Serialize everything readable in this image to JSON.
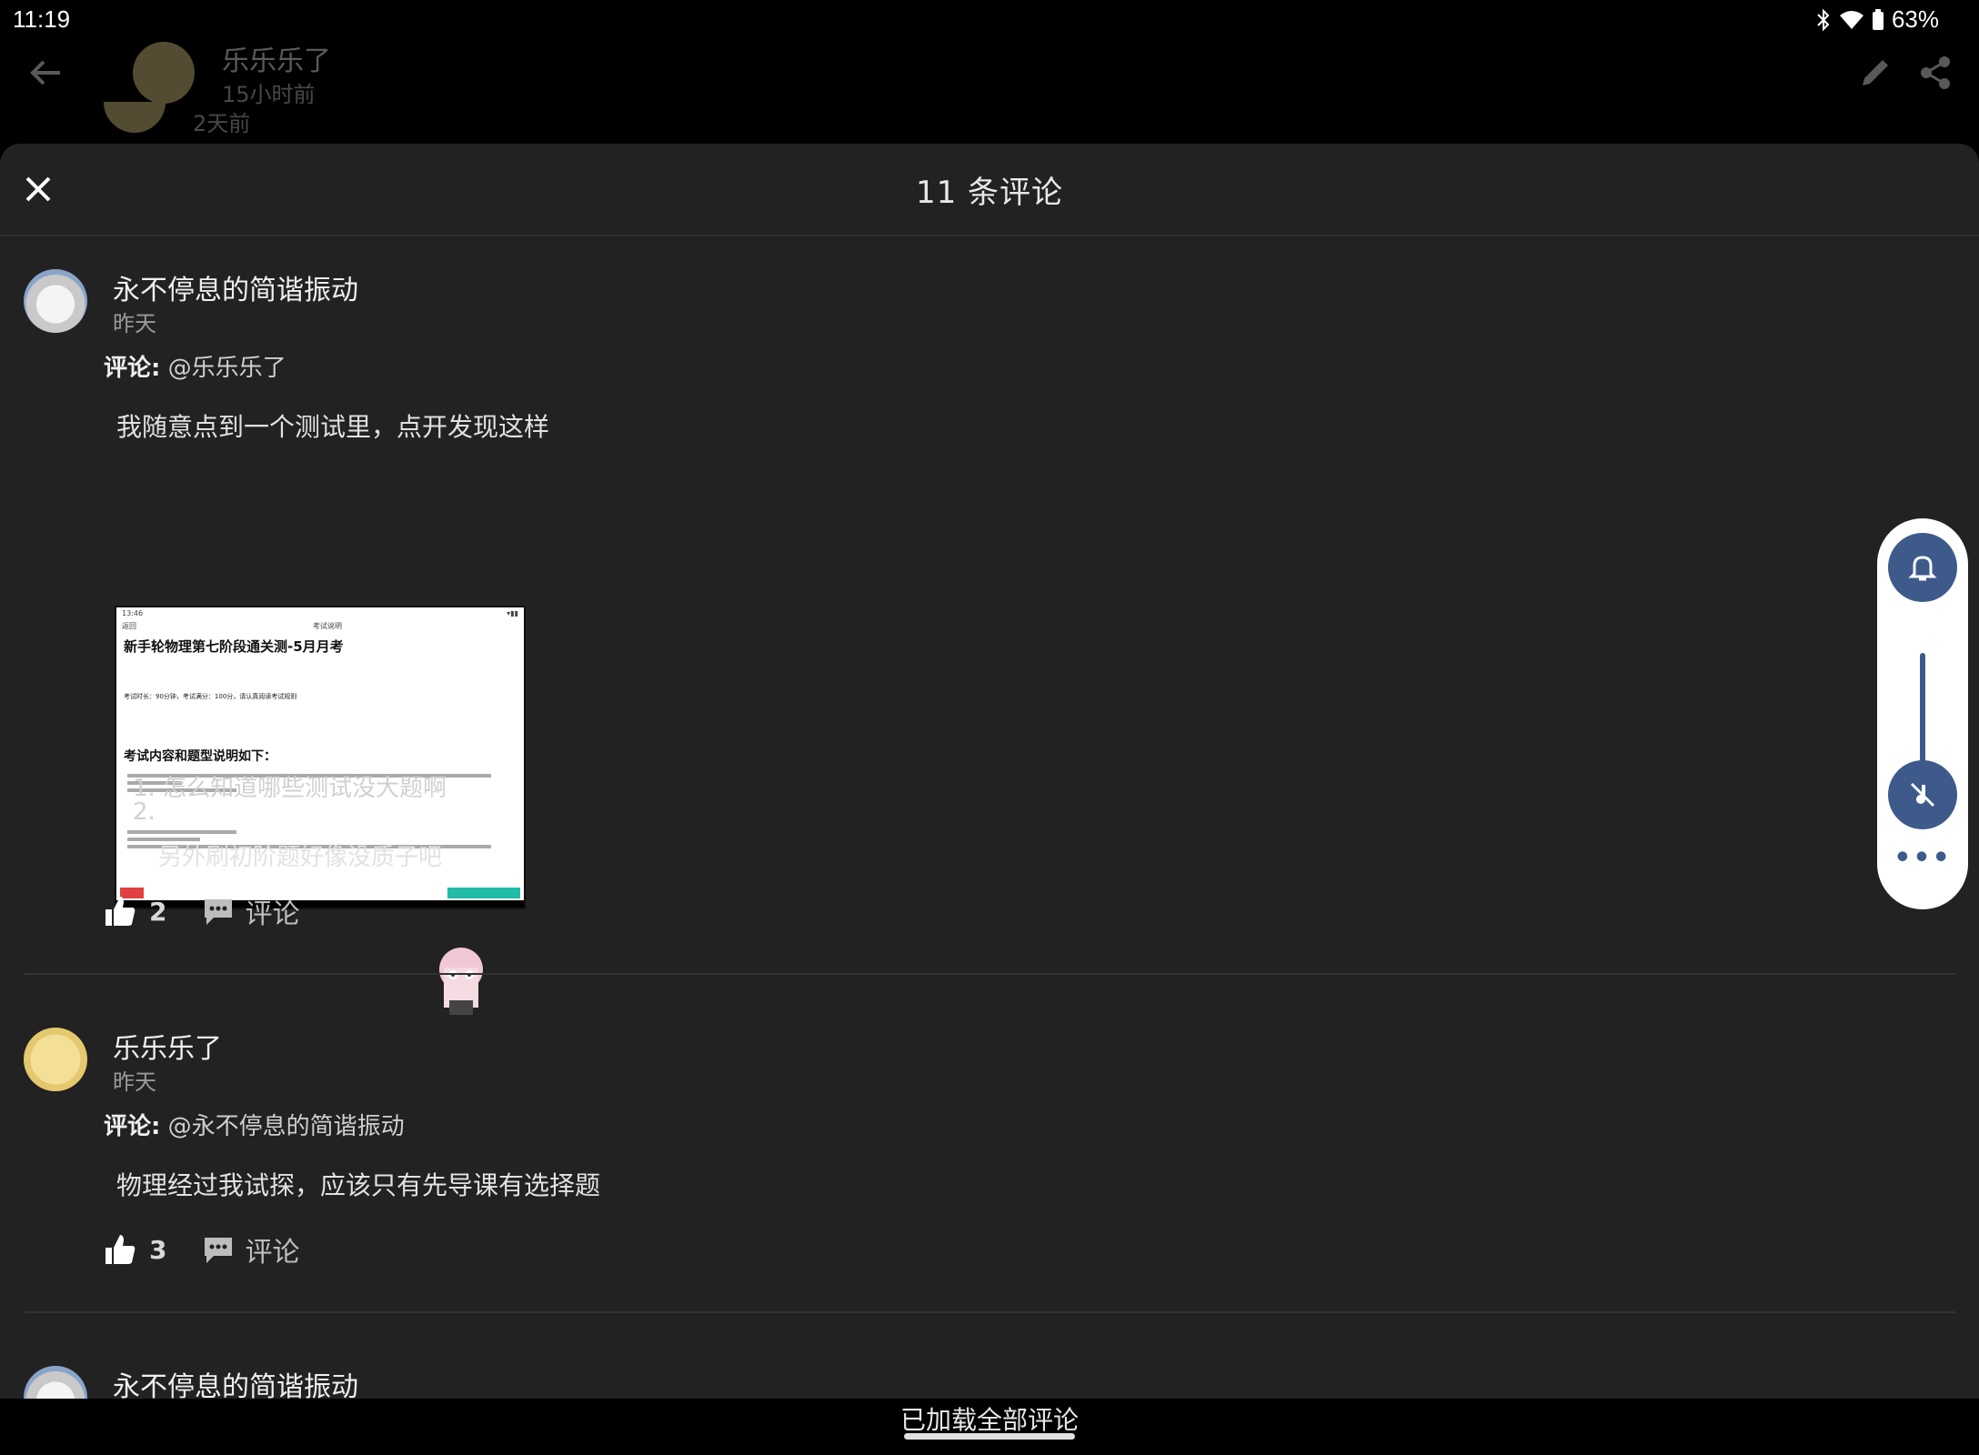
{
  "status": {
    "time": "11:19",
    "battery": "63%"
  },
  "header": {
    "author": "乐乐乐了",
    "time": "15小时前",
    "time_behind": "2天前"
  },
  "sheet": {
    "title": "11 条评论"
  },
  "comments": [
    {
      "user": "永不停息的简谐振动",
      "time": "昨天",
      "reply_label": "评论:",
      "reply_to": "@乐乐乐了",
      "text": "我随意点到一个测试里，点开发现这样",
      "image": {
        "status_time": "13:46",
        "back": "返回",
        "nav_title": "考试说明",
        "title": "新手轮物理第七阶段通关测-5月月考",
        "info": "考试时长：90分钟，考试满分：100分，请认真阅读考试规则",
        "section": "考试内容和题型说明如下："
      },
      "list": [
        "1. 怎么知道哪些测试没大题啊",
        "2."
      ],
      "extra": "另外刷初阶题好像没质子吧",
      "likes": "2",
      "comment_action": "评论"
    },
    {
      "user": "乐乐乐了",
      "time": "昨天",
      "reply_label": "评论:",
      "reply_to": "@永不停息的简谐振动",
      "text": "物理经过我试探，应该只有先导课有选择题",
      "likes": "3",
      "comment_action": "评论"
    },
    {
      "user": "永不停息的简谐振动"
    }
  ],
  "footer": {
    "loaded": "已加载全部评论"
  },
  "colors": {
    "accent": "#3d5a8a",
    "sheet": "#222222"
  }
}
